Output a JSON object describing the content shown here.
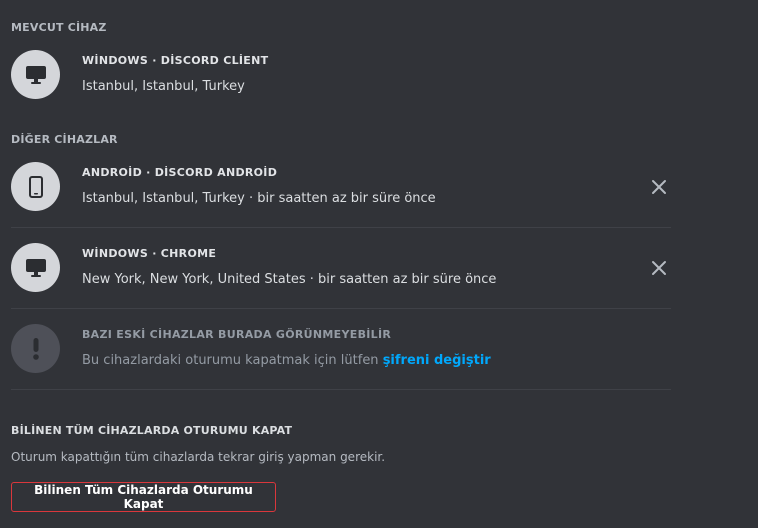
{
  "current_device": {
    "section_title": "MEVCUT CİHAZ",
    "icon": "monitor-icon",
    "title": "WİNDOWS · DİSCORD CLİENT",
    "location": "Istanbul, Istanbul, Turkey"
  },
  "other_devices": {
    "section_title": "DİĞER CİHAZLAR",
    "items": [
      {
        "icon": "phone-icon",
        "title": "ANDROİD · DİSCORD ANDROİD",
        "location": "Istanbul, Istanbul, Turkey · bir saatten az bir süre önce",
        "close_icon": "close-icon"
      },
      {
        "icon": "monitor-icon",
        "title": "WİNDOWS · CHROME",
        "location": "New York, New York, United States · bir saatten az bir süre önce",
        "close_icon": "close-icon"
      }
    ],
    "notice": {
      "icon": "exclamation-icon",
      "title": "BAZI ESKİ CİHAZLAR BURADA GÖRÜNMEYEBİLİR",
      "text_before_link": "Bu cihazlardaki oturumu kapatmak için lütfen ",
      "link_text": "şifreni değiştir"
    }
  },
  "logout_all": {
    "title": "BİLİNEN TÜM CİHAZLARDA OTURUMU KAPAT",
    "description": "Oturum kapattığın tüm cihazlarda tekrar giriş yapman gerekir.",
    "button_label": "Bilinen Tüm Cihazlarda Oturumu Kapat"
  },
  "colors": {
    "background": "#313338",
    "icon_circle": "#d4d6da",
    "link": "#00a8fc",
    "danger": "#da373c"
  }
}
